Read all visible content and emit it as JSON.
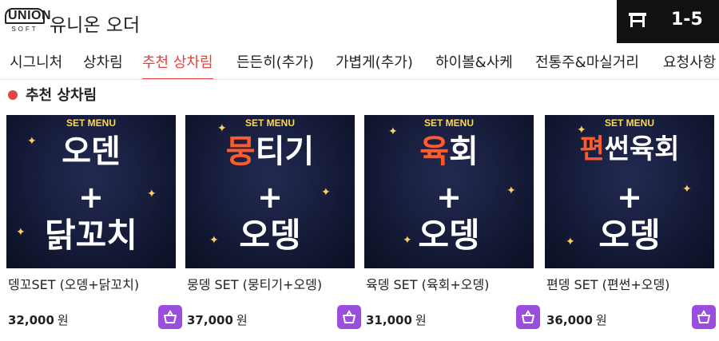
{
  "header": {
    "logo_top": "UNION",
    "logo_bottom": "SOFT",
    "title": "유니온 오더",
    "table_icon": "table-icon",
    "table_number": "1-5"
  },
  "tabs": [
    {
      "label": "시그니처",
      "active": false
    },
    {
      "label": "상차림",
      "active": false
    },
    {
      "label": "추천 상차림",
      "active": true
    },
    {
      "label": "든든히(추가)",
      "active": false
    },
    {
      "label": "가볍게(추가)",
      "active": false
    },
    {
      "label": "하이볼&사케",
      "active": false
    },
    {
      "label": "전통주&마실거리",
      "active": false
    },
    {
      "label": "요청사항",
      "active": false
    }
  ],
  "section": {
    "title": "추천 상차림"
  },
  "colors": {
    "accent": "#e2453f",
    "cart_button": "#9a4ee0",
    "image_bg": "#141a36",
    "set_menu": "#ffd84a",
    "highlight": "#ff5a2c"
  },
  "products": [
    {
      "set_menu": "SET MENU",
      "line1_hl": "",
      "line1": "오덴",
      "line2": "+",
      "line3": "닭꼬치",
      "name": "뎅꼬SET (오뎅+닭꼬치)",
      "price": "32,000",
      "currency": "원",
      "cart_icon": "basket-icon"
    },
    {
      "set_menu": "SET MENU",
      "line1_hl": "뭉",
      "line1": "티기",
      "line2": "+",
      "line3": "오뎅",
      "name": "뭉뎅 SET (뭉티기+오뎅)",
      "price": "37,000",
      "currency": "원",
      "cart_icon": "basket-icon"
    },
    {
      "set_menu": "SET MENU",
      "line1_hl": "육",
      "line1": "회",
      "line2": "+",
      "line3": "오뎅",
      "name": "육뎅 SET (육회+오뎅)",
      "price": "31,000",
      "currency": "원",
      "cart_icon": "basket-icon"
    },
    {
      "set_menu": "SET MENU",
      "line1_hl": "편",
      "line1": "썬육회",
      "line2": "+",
      "line3": "오뎅",
      "name": "편뎅 SET (편썬+오뎅)",
      "price": "36,000",
      "currency": "원",
      "cart_icon": "basket-icon"
    }
  ]
}
